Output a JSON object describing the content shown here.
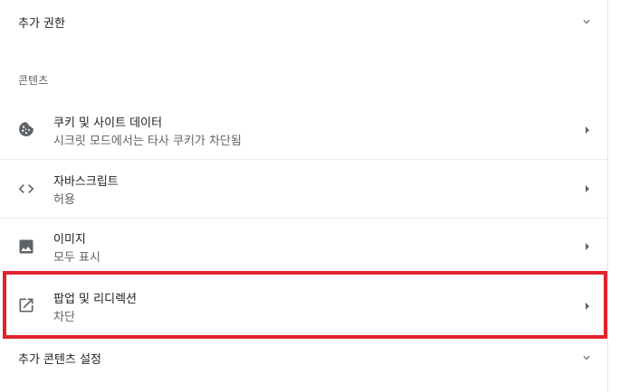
{
  "extra_permissions": {
    "label": "추가 권한"
  },
  "content_header": "콘텐츠",
  "items": [
    {
      "title": "쿠키 및 사이트 데이터",
      "subtitle": "시크릿 모드에서는 타사 쿠키가 차단됨",
      "icon": "cookie-icon"
    },
    {
      "title": "자바스크립트",
      "subtitle": "허용",
      "icon": "code-icon"
    },
    {
      "title": "이미지",
      "subtitle": "모두 표시",
      "icon": "image-icon"
    },
    {
      "title": "팝업 및 리디렉션",
      "subtitle": "차단",
      "icon": "open-in-new-icon"
    }
  ],
  "extra_content_settings": {
    "label": "추가 콘텐츠 설정"
  },
  "colors": {
    "highlight": "#e0232e",
    "icon": "#5f6368",
    "divider": "#e8eaed"
  }
}
